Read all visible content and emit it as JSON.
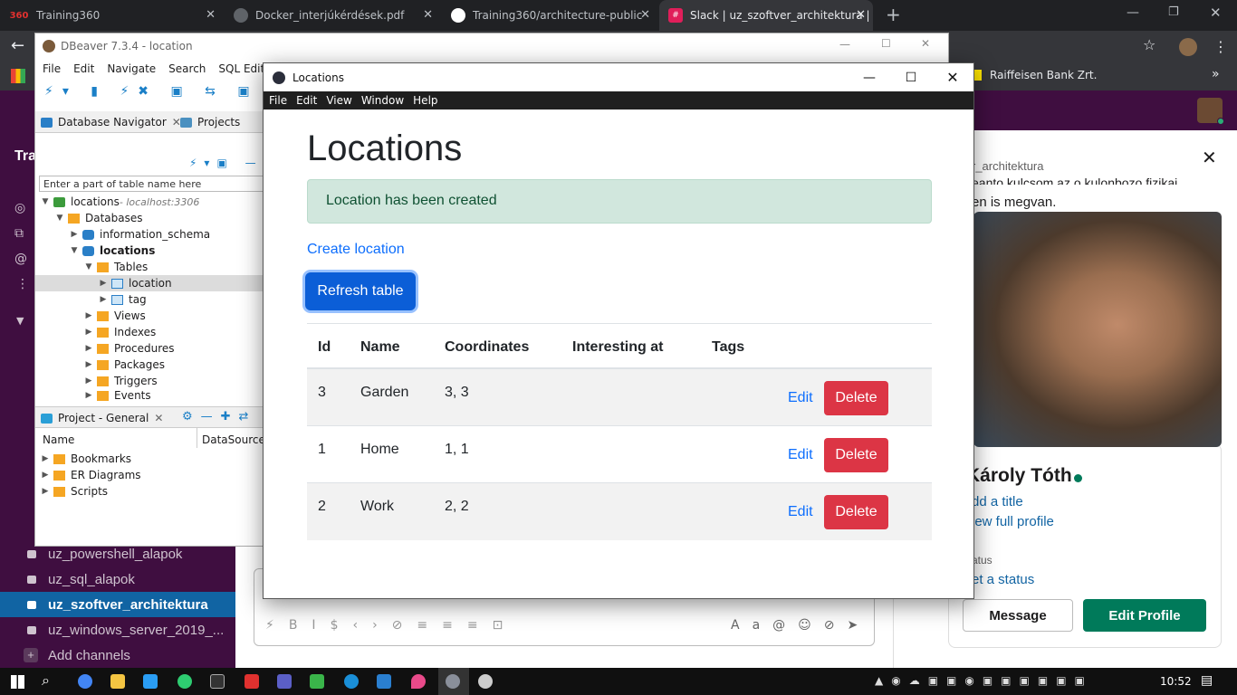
{
  "chrome": {
    "tabs": [
      {
        "label": "Training360",
        "icon": "training360-icon"
      },
      {
        "label": "Docker_interjúkérdések.pdf",
        "icon": "pdf-icon"
      },
      {
        "label": "Training360/architecture-public",
        "icon": "github-icon"
      },
      {
        "label": "Slack | uz_szoftver_architektura |",
        "icon": "slack-icon"
      }
    ],
    "new_tab": "+",
    "bookmark": "Raiffeisen Bank Zrt.",
    "more": "»"
  },
  "slack": {
    "workspace_partial": "Tra",
    "channels": [
      {
        "name": "uz_powershell_alapok"
      },
      {
        "name": "uz_sql_alapok"
      },
      {
        "name": "uz_szoftver_architektura"
      },
      {
        "name": "uz_windows_server_2019_..."
      }
    ],
    "add_channels": "Add channels",
    "right_panel": {
      "header_partial": "r_architektura",
      "message_partial_1": "eanto kulcsom az o kulonbozo fizikai",
      "message_partial_2": "en is megvan.",
      "name_partial": "Károly Tóth",
      "add_title": "dd a title",
      "view_profile": "iew full profile",
      "status_label": "atus",
      "set_status": "et a status",
      "message_button": "Message",
      "edit_profile_button": "Edit Profile"
    }
  },
  "dbeaver": {
    "title": "DBeaver 7.3.4 - location",
    "menu": [
      "File",
      "Edit",
      "Navigate",
      "Search",
      "SQL Editor"
    ],
    "nav_tab": "Database Navigator",
    "projects_tab": "Projects",
    "filter_placeholder": "Enter a part of table name here",
    "tree": {
      "connection": "locations",
      "connection_host": " - localhost:3306",
      "databases": "Databases",
      "info_schema": "information_schema",
      "locations_db": "locations",
      "tables": "Tables",
      "table_location": "location",
      "table_tag": "tag",
      "views": "Views",
      "indexes": "Indexes",
      "procedures": "Procedures",
      "packages": "Packages",
      "triggers": "Triggers",
      "events": "Events"
    },
    "project_panel": {
      "title": "Project - General",
      "col_name": "Name",
      "col_datasource": "DataSource",
      "items": [
        "Bookmarks",
        "ER Diagrams",
        "Scripts"
      ]
    }
  },
  "locations_app": {
    "window_title": "Locations",
    "menu": [
      "File",
      "Edit",
      "View",
      "Window",
      "Help"
    ],
    "heading": "Locations",
    "alert": "Location has been created",
    "create_link": "Create location",
    "refresh_button": "Refresh table",
    "columns": [
      "Id",
      "Name",
      "Coordinates",
      "Interesting at",
      "Tags"
    ],
    "rows": [
      {
        "id": "3",
        "name": "Garden",
        "coordinates": "3, 3",
        "interesting_at": "",
        "tags": ""
      },
      {
        "id": "1",
        "name": "Home",
        "coordinates": "1, 1",
        "interesting_at": "",
        "tags": ""
      },
      {
        "id": "2",
        "name": "Work",
        "coordinates": "2, 2",
        "interesting_at": "",
        "tags": ""
      }
    ],
    "edit_label": "Edit",
    "delete_label": "Delete"
  },
  "taskbar": {
    "time": "10:52"
  },
  "colors": {
    "slack_purple": "#3f0e40",
    "slack_active": "#1164a3",
    "bootstrap_primary": "#0d6efd",
    "bootstrap_danger": "#dc3545",
    "alert_success_bg": "#d1e7dd",
    "slack_green": "#007a5a"
  }
}
